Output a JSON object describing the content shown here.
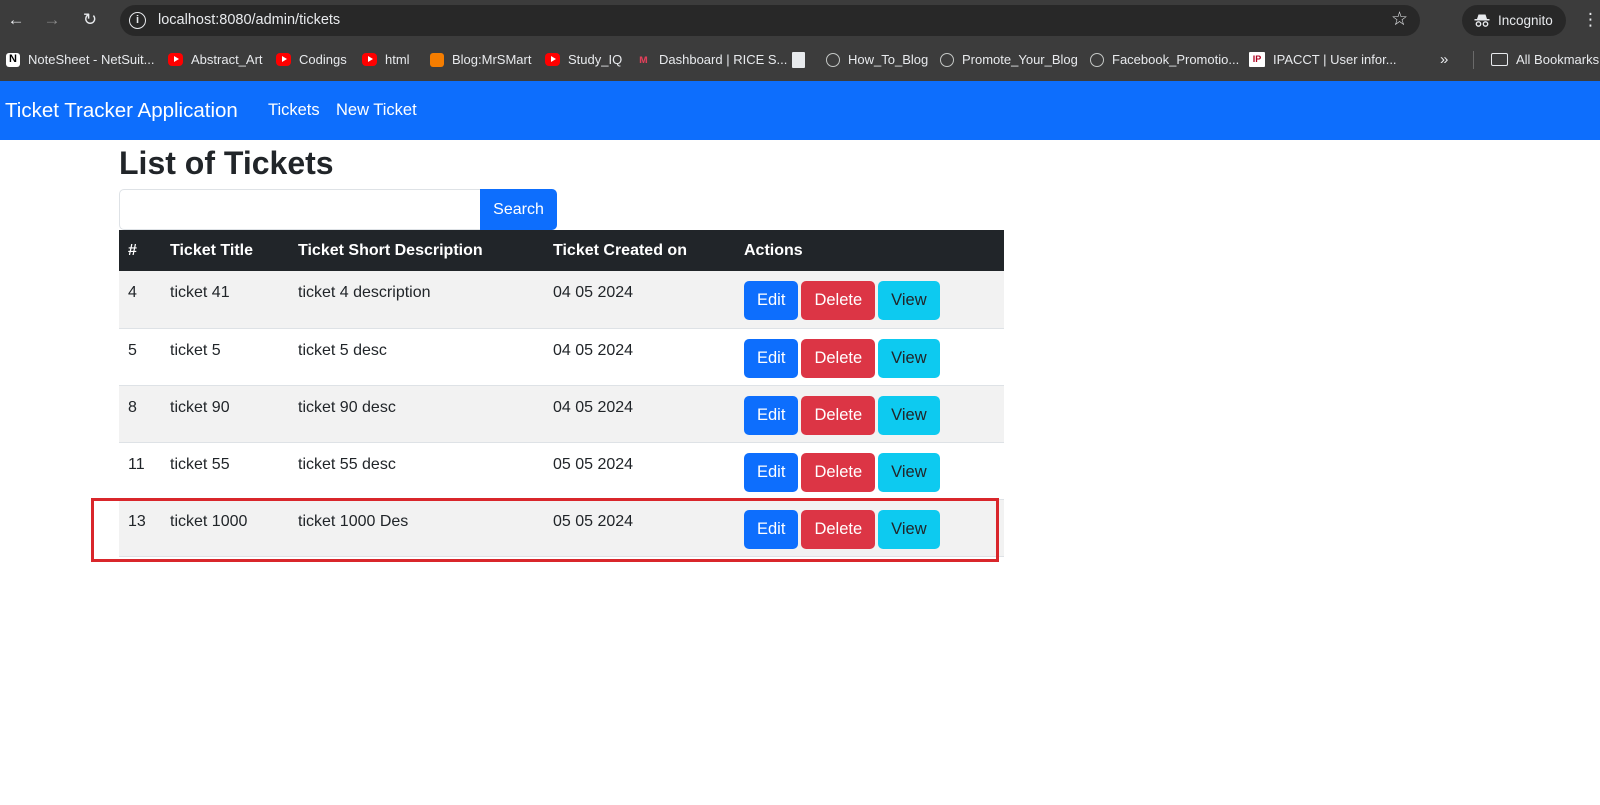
{
  "browser": {
    "url": "localhost:8080/admin/tickets",
    "incognito_label": "Incognito",
    "bookmarks": [
      {
        "label": "NoteSheet - NetSuit...",
        "icon": "notion-icon"
      },
      {
        "label": "Abstract_Art",
        "icon": "youtube-icon"
      },
      {
        "label": "Codings",
        "icon": "youtube-icon"
      },
      {
        "label": "html",
        "icon": "youtube-icon"
      },
      {
        "label": "Blog:MrSMart",
        "icon": "blogger-icon"
      },
      {
        "label": "Study_IQ",
        "icon": "youtube-icon"
      },
      {
        "label": "Dashboard | RICE S...",
        "icon": "rice-icon"
      },
      {
        "label": "",
        "icon": "stack-icon"
      },
      {
        "label": "How_To_Blog",
        "icon": "globe-icon"
      },
      {
        "label": "Promote_Your_Blog",
        "icon": "globe-icon"
      },
      {
        "label": "Facebook_Promotio...",
        "icon": "globe-icon"
      },
      {
        "label": "IPACCT | User infor...",
        "icon": "ipacct-icon"
      }
    ],
    "all_bookmarks_label": "All Bookmarks"
  },
  "app": {
    "brand": "Ticket Tracker Application",
    "nav": {
      "tickets": "Tickets",
      "new_ticket": "New Ticket"
    },
    "accent_color": "#0d6efd"
  },
  "main": {
    "title": "List of Tickets",
    "search": {
      "value": "",
      "button_label": "Search"
    },
    "table": {
      "headers": {
        "num": "#",
        "title": "Ticket Title",
        "desc": "Ticket Short Description",
        "created": "Ticket Created on",
        "actions": "Actions"
      },
      "rows": [
        {
          "id": "4",
          "title": "ticket 41",
          "desc": "ticket 4 description",
          "created": "04 05 2024"
        },
        {
          "id": "5",
          "title": "ticket 5",
          "desc": "ticket 5 desc",
          "created": "04 05 2024"
        },
        {
          "id": "8",
          "title": "ticket 90",
          "desc": "ticket 90 desc",
          "created": "04 05 2024"
        },
        {
          "id": "11",
          "title": "ticket 55",
          "desc": "ticket 55 desc",
          "created": "05 05 2024"
        },
        {
          "id": "13",
          "title": "ticket 1000",
          "desc": "ticket 1000 Des",
          "created": "05 05 2024"
        }
      ],
      "row_actions": {
        "edit": "Edit",
        "delete": "Delete",
        "view": "View"
      }
    }
  }
}
